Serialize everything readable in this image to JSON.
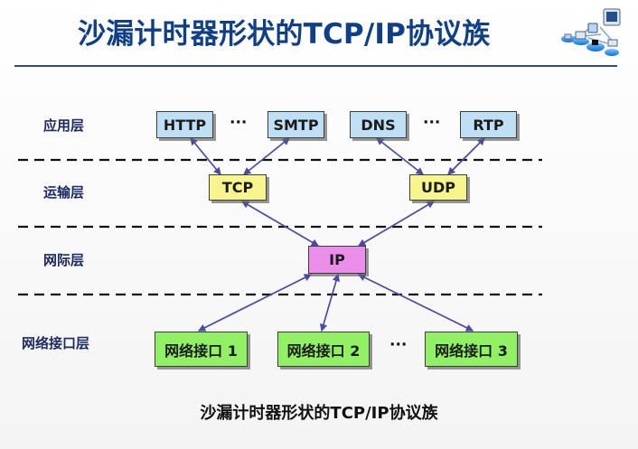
{
  "title": "沙漏计时器形状的TCP/IP协议族",
  "caption": "沙漏计时器形状的TCP/IP协议族",
  "layers": {
    "application": "应用层",
    "transport": "运输层",
    "internet": "网际层",
    "network_interface": "网络接口层"
  },
  "nodes": {
    "http": "HTTP",
    "smtp": "SMTP",
    "dns": "DNS",
    "rtp": "RTP",
    "tcp": "TCP",
    "udp": "UDP",
    "ip": "IP",
    "ni1": "网络接口 1",
    "ni2": "网络接口 2",
    "ni3": "网络接口 3"
  },
  "ellipsis": {
    "app_left": "···",
    "app_right": "···",
    "bottom": "···"
  },
  "colors": {
    "title": "#0f3f88",
    "app_box": "#bfe0f4",
    "transport_box": "#f7f58e",
    "ip_box": "#ea8ee9",
    "interface_box": "#91f063",
    "arrow": "#4b4aa4"
  },
  "icons": {
    "logo": "network-devices-icon"
  }
}
